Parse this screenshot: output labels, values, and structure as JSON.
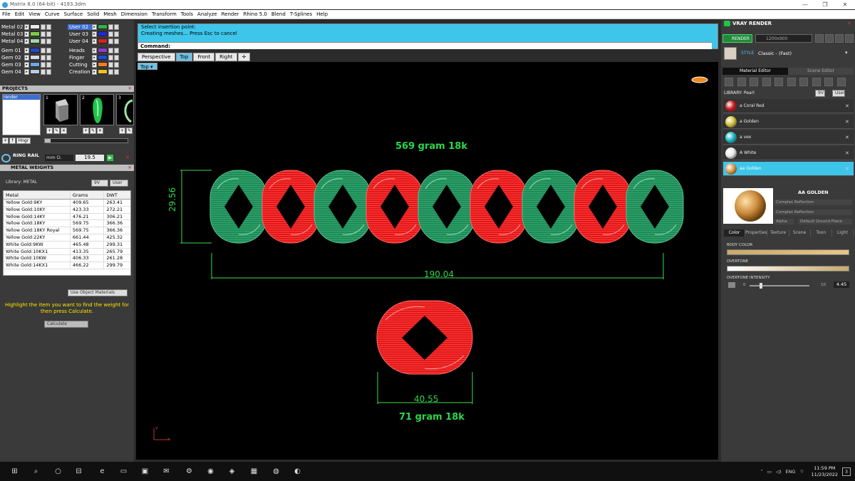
{
  "window": {
    "title": "Matrix 8.0 (64-bit) - 4193.3dm"
  },
  "menu": [
    "File",
    "Edit",
    "View",
    "Curve",
    "Surface",
    "Solid",
    "Mesh",
    "Dimension",
    "Transform",
    "Tools",
    "Analyze",
    "Render",
    "Rhino 5.0",
    "Blend",
    "T-Splines",
    "Help"
  ],
  "layers": {
    "left": [
      {
        "name": "Metal 02",
        "color": "#e8e8e8"
      },
      {
        "name": "Metal 03",
        "color": "#7ecb4a"
      },
      {
        "name": "Metal 04",
        "color": "#9fd7a2"
      },
      {
        "name": "Gem 01",
        "color": "#2548c8"
      },
      {
        "name": "Gem 02",
        "color": "#d8d8e8"
      },
      {
        "name": "Gem 03",
        "color": "#6aa7e6"
      },
      {
        "name": "Gem 04",
        "color": "#b9cbe6"
      }
    ],
    "right": [
      {
        "name": "User 02",
        "color": "#2bb34a",
        "selected": true
      },
      {
        "name": "User 03",
        "color": "#2029d6"
      },
      {
        "name": "User 04",
        "color": "#e01f1f"
      },
      {
        "name": "Heads",
        "color": "#8e3dc8"
      },
      {
        "name": "Finger",
        "color": "#2048e0"
      },
      {
        "name": "Cutting",
        "color": "#f07f1e"
      },
      {
        "name": "Creation",
        "color": "#f0c21e"
      }
    ]
  },
  "projects": {
    "title": "PROJECTS",
    "list": [
      "render"
    ],
    "thumbs": [
      "1",
      "2",
      "3"
    ],
    "ring_label": "RING RAIL",
    "unit": "mm D.",
    "value": "19.5",
    "hinge_label": "Hngr"
  },
  "metal_weights": {
    "title": "METAL WEIGHTS",
    "library_label": "Library: METAL",
    "btn_9v": "9V",
    "btn_user": "User",
    "headers": [
      "Metal",
      "Grams",
      "DWT"
    ],
    "rows": [
      [
        "Yellow Gold:9KY",
        "409.65",
        "263.41"
      ],
      [
        "Yellow Gold:10KY",
        "423.33",
        "272.21"
      ],
      [
        "Yellow Gold:14KY",
        "476.21",
        "306.21"
      ],
      [
        "Yellow Gold:18KY",
        "569.75",
        "366.36"
      ],
      [
        "Yellow Gold:18KY Royal",
        "569.75",
        "366.36"
      ],
      [
        "Yellow Gold:22KY",
        "661.44",
        "425.32"
      ],
      [
        "White Gold:9KW",
        "465.48",
        "299.31"
      ],
      [
        "White Gold:10KX1",
        "413.35",
        "265.79"
      ],
      [
        "White Gold:10KW",
        "406.33",
        "261.28"
      ],
      [
        "White Gold:14KX1",
        "466.22",
        "299.79"
      ]
    ],
    "use_object": "Use Object Materials",
    "hint": "Highlight the item you want to find the weight for then press Calculate.",
    "calculate": "Calculate"
  },
  "command": {
    "line1": "Select insertion point:",
    "line2": "Creating meshes... Press Esc to cancel",
    "prompt": "Command:"
  },
  "viewtabs": [
    "Perspective",
    "Top",
    "Front",
    "Right"
  ],
  "viewport": {
    "label": "Top",
    "top_weight": "569 gram 18k",
    "height_dim": "29.56",
    "width_dim": "190.04",
    "bottom_dim": "40.55",
    "bottom_weight": "71 gram 18k",
    "axis_y": "y",
    "axis_x": "x"
  },
  "vray": {
    "title": "VRAY RENDER",
    "render_btn": "RENDER",
    "resolution": "1200x900",
    "style_label": "STYLE",
    "style_value": "Classic - (Fast)",
    "tab_material": "Material Editor",
    "tab_scene": "Scene Editor",
    "library_label": "LIBRARY: Pearl",
    "materials": [
      {
        "name": "a Coral Red",
        "color": "#c81818"
      },
      {
        "name": "a Golden",
        "color": "#d4c23a"
      },
      {
        "name": "a vex",
        "color": "#1bb6c4"
      },
      {
        "name": "A White",
        "color": "#e8e8e8"
      },
      {
        "name": "aa Golden",
        "color": "#d8964a",
        "selected": true
      }
    ],
    "preview_name": "AA GOLDEN",
    "preview_type": "Complex Reflection",
    "alpha": "Alpha",
    "ground": "Default Ground Plane",
    "prop_tabs": [
      "Color",
      "Properties",
      "Texture",
      "Scene",
      "Toon",
      "Light"
    ],
    "body_color": "BODY COLOR",
    "overtone": "OVERTONE",
    "overtone_intensity": "OVERTONE INTENSITY",
    "oi_min": "0",
    "oi_max": "10",
    "oi_value": "4.45"
  },
  "taskbar": {
    "lang": "ENG",
    "time": "11:59 PM",
    "date": "11/23/2022",
    "notify": "3"
  }
}
